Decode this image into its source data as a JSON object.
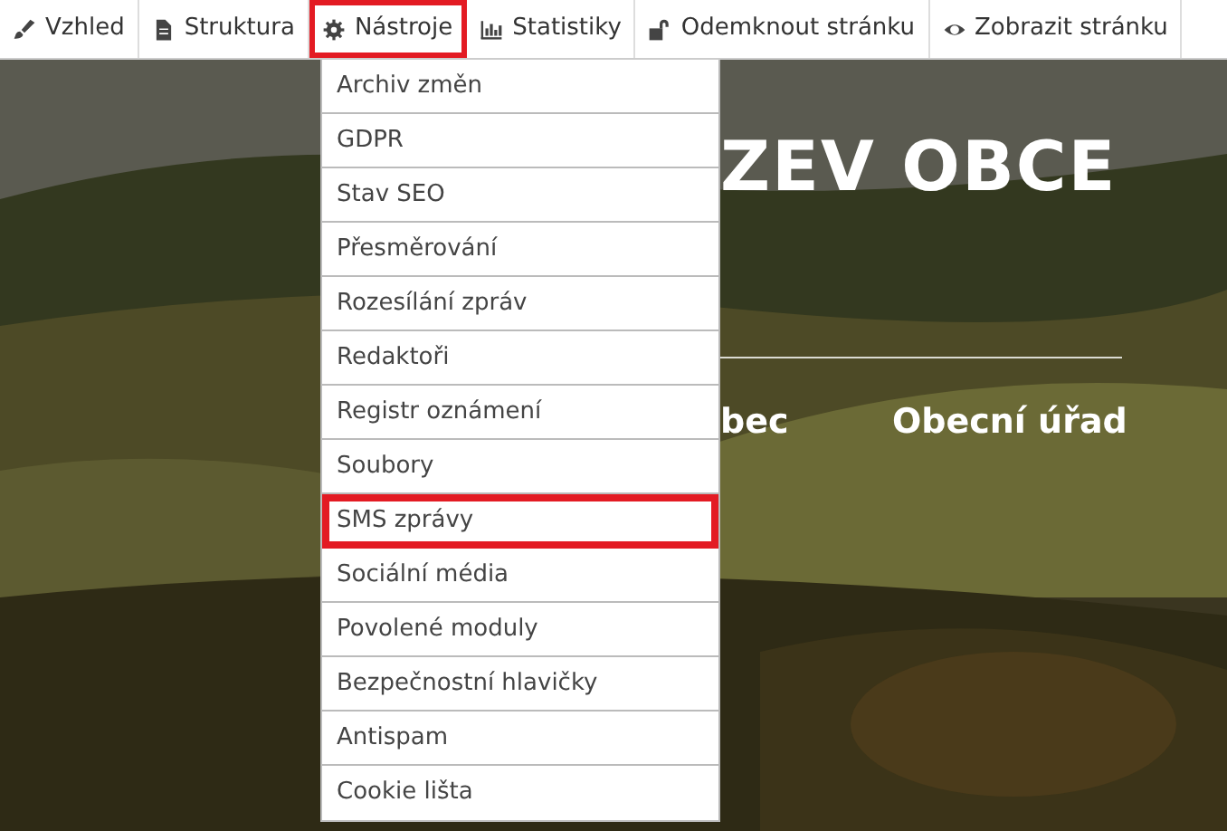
{
  "toolbar": {
    "items": [
      {
        "label": "Vzhled",
        "highlighted": false
      },
      {
        "label": "Struktura",
        "highlighted": false
      },
      {
        "label": "Nástroje",
        "highlighted": true
      },
      {
        "label": "Statistiky",
        "highlighted": false
      },
      {
        "label": "Odemknout stránku",
        "highlighted": false
      },
      {
        "label": "Zobrazit stránku",
        "highlighted": false
      }
    ]
  },
  "dropdown": {
    "items": [
      {
        "label": "Archiv změn",
        "highlighted": false
      },
      {
        "label": "GDPR",
        "highlighted": false
      },
      {
        "label": "Stav SEO",
        "highlighted": false
      },
      {
        "label": "Přesměrování",
        "highlighted": false
      },
      {
        "label": "Rozesílání zpráv",
        "highlighted": false
      },
      {
        "label": "Redaktoři",
        "highlighted": false
      },
      {
        "label": "Registr oznámení",
        "highlighted": false
      },
      {
        "label": "Soubory",
        "highlighted": false
      },
      {
        "label": "SMS zprávy",
        "highlighted": true
      },
      {
        "label": "Sociální média",
        "highlighted": false
      },
      {
        "label": "Povolené moduly",
        "highlighted": false
      },
      {
        "label": "Bezpečnostní hlavičky",
        "highlighted": false
      },
      {
        "label": "Antispam",
        "highlighted": false
      },
      {
        "label": "Cookie lišta",
        "highlighted": false
      }
    ]
  },
  "hero": {
    "title": "ZEV OBCE",
    "nav": [
      "bec",
      "Obecní úřad"
    ]
  }
}
